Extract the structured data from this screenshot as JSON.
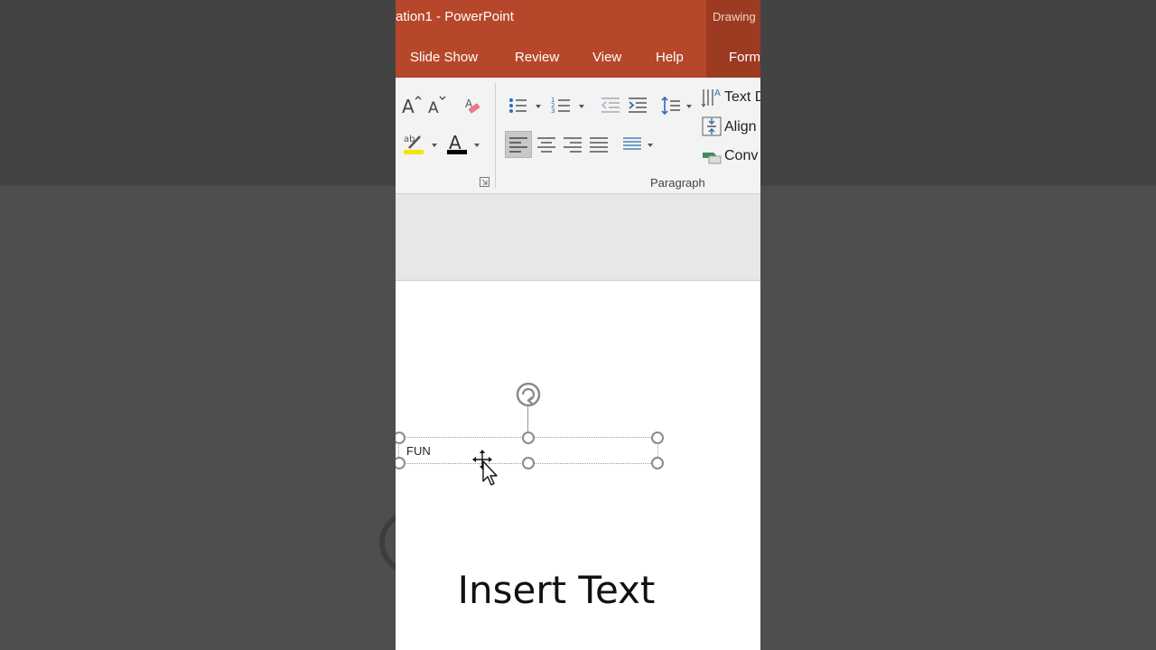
{
  "window": {
    "title": "ation1  -  PowerPoint",
    "context_tab_group": "Drawing"
  },
  "tabs": [
    "Slide Show",
    "Review",
    "View",
    "Help",
    "Form"
  ],
  "ribbon": {
    "text_direction_label": "Text D",
    "align_text_label": "Align",
    "convert_label": "Conv",
    "paragraph_group_label": "Paragraph",
    "highlight_color": "#f2e600",
    "font_color": "#000000"
  },
  "slide": {
    "textbox_text": "FUN"
  },
  "caption": "Insert Text",
  "colors": {
    "accent": "#b7472a",
    "accent_dark": "#9c3a22"
  }
}
